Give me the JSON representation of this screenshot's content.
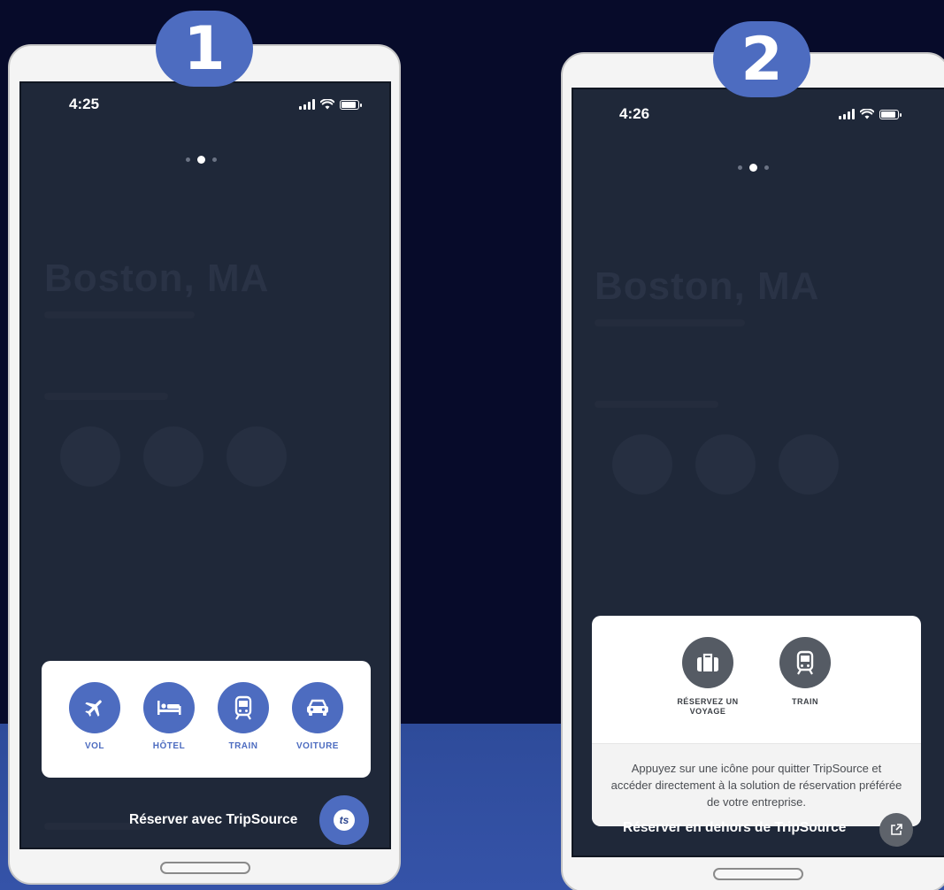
{
  "colors": {
    "background": "#070b2a",
    "accent": "#4d6cc0",
    "screen": "#1f2839"
  },
  "badges": [
    "1",
    "2"
  ],
  "phone1": {
    "time": "4:25",
    "options": [
      {
        "label": "VOL",
        "icon": "plane-icon"
      },
      {
        "label": "HÔTEL",
        "icon": "bed-icon"
      },
      {
        "label": "TRAIN",
        "icon": "train-icon"
      },
      {
        "label": "VOITURE",
        "icon": "car-icon"
      }
    ],
    "book_label": "Réserver avec TripSource",
    "ts_logo": "ts"
  },
  "phone2": {
    "time": "4:26",
    "options": [
      {
        "label": "RÉSERVEZ UN VOYAGE",
        "icon": "suitcase-icon"
      },
      {
        "label": "TRAIN",
        "icon": "train-icon"
      }
    ],
    "info_text": "Appuyez sur une icône pour quitter TripSource et accéder directement à la solution de réservation préférée de votre entreprise.",
    "book_label": "Réserver en dehors de TripSource",
    "external_icon": "external-link-icon"
  },
  "background_title": "Boston, MA"
}
